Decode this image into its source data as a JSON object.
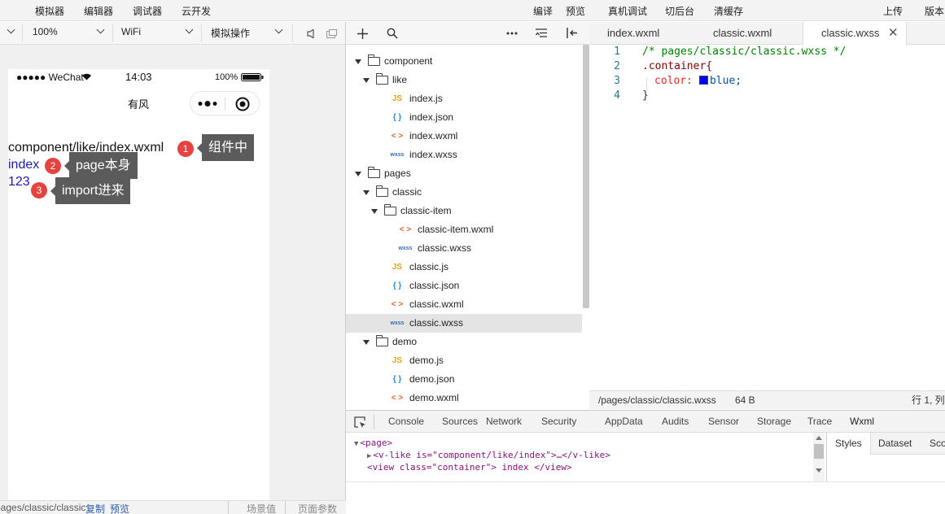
{
  "menubar": {
    "left": [
      "模拟器",
      "编辑器",
      "调试器",
      "云开发"
    ],
    "center": [
      "编译",
      "预览",
      "真机调试",
      "切后台",
      "清缓存"
    ],
    "right": [
      "上传",
      "版本"
    ]
  },
  "toolbar": {
    "zoom": "100%",
    "network": "WiFi",
    "operation": "模拟操作"
  },
  "phone": {
    "carrier": "●●●●● WeChat",
    "time": "14:03",
    "battery": "100%",
    "nav_title": "有风",
    "lines": [
      {
        "text": "component/like/index.wxml",
        "color": "#111111"
      },
      {
        "text": "index",
        "color": "#1a1ab8"
      },
      {
        "text": "123",
        "color": "#1a1ab8"
      }
    ],
    "annotations": [
      {
        "num": "1",
        "label": "组件中"
      },
      {
        "num": "2",
        "label": "page本身"
      },
      {
        "num": "3",
        "label": "import进来"
      }
    ]
  },
  "sim_status": {
    "path": "pages/classic/classic",
    "copy": "复制",
    "preview": "预览",
    "scene": "场景值",
    "params": "页面参数"
  },
  "tree": [
    {
      "label": "component",
      "type": "folder",
      "depth": 0
    },
    {
      "label": "like",
      "type": "folder",
      "depth": 1
    },
    {
      "label": "index.js",
      "type": "js",
      "depth": 2
    },
    {
      "label": "index.json",
      "type": "json",
      "depth": 2
    },
    {
      "label": "index.wxml",
      "type": "wxml",
      "depth": 2
    },
    {
      "label": "index.wxss",
      "type": "wxss",
      "depth": 2
    },
    {
      "label": "pages",
      "type": "folder",
      "depth": 0
    },
    {
      "label": "classic",
      "type": "folder",
      "depth": 1
    },
    {
      "label": "classic-item",
      "type": "folder",
      "depth": 2
    },
    {
      "label": "classic-item.wxml",
      "type": "wxml",
      "depth": 3
    },
    {
      "label": "classic.wxss",
      "type": "wxss",
      "depth": 3
    },
    {
      "label": "classic.js",
      "type": "js",
      "depth": 2
    },
    {
      "label": "classic.json",
      "type": "json",
      "depth": 2
    },
    {
      "label": "classic.wxml",
      "type": "wxml",
      "depth": 2
    },
    {
      "label": "classic.wxss",
      "type": "wxss",
      "depth": 2,
      "selected": true
    },
    {
      "label": "demo",
      "type": "folder",
      "depth": 1
    },
    {
      "label": "demo.js",
      "type": "js",
      "depth": 2
    },
    {
      "label": "demo.json",
      "type": "json",
      "depth": 2
    },
    {
      "label": "demo.wxml",
      "type": "wxml",
      "depth": 2
    }
  ],
  "icons": {
    "js": "JS",
    "json": "{ }",
    "wxml": "< >",
    "wxss": "wxss"
  },
  "editor_tabs": [
    {
      "label": "index.wxml",
      "active": false
    },
    {
      "label": "classic.wxml",
      "active": false
    },
    {
      "label": "classic.wxss",
      "active": true
    }
  ],
  "code": [
    {
      "num": "1",
      "text": "/* pages/classic/classic.wxss */"
    },
    {
      "num": "2",
      "text": ".container{"
    },
    {
      "num": "3",
      "prop": "color:",
      "value": "blue;"
    },
    {
      "num": "4",
      "text": "}"
    }
  ],
  "editor_status": {
    "path": "/pages/classic/classic.wxss",
    "size": "64 B",
    "position": "行 1, 列"
  },
  "devtools_tabs": [
    "Console",
    "Sources",
    "Network",
    "Security",
    "AppData",
    "Audits",
    "Sensor",
    "Storage",
    "Trace",
    "Wxml"
  ],
  "devtools_active": "Wxml",
  "wxml_lines": [
    "<page>",
    "<v-like  is=\"component/like/index\">…</v-like>",
    "<view  class=\"container\"> index </view>"
  ],
  "side_tabs": [
    "Styles",
    "Dataset",
    "Sco"
  ],
  "colors": {
    "accent": "#1aad19",
    "badge": "#e64340",
    "selected": "#e4e4e4"
  }
}
